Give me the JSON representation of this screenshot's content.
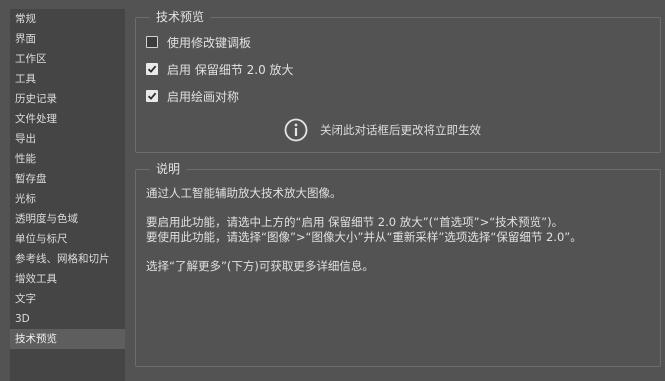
{
  "sidebar": {
    "items": [
      {
        "label": "常规"
      },
      {
        "label": "界面"
      },
      {
        "label": "工作区"
      },
      {
        "label": "工具"
      },
      {
        "label": "历史记录"
      },
      {
        "label": "文件处理"
      },
      {
        "label": "导出"
      },
      {
        "label": "性能"
      },
      {
        "label": "暂存盘"
      },
      {
        "label": "光标"
      },
      {
        "label": "透明度与色域"
      },
      {
        "label": "单位与标尺"
      },
      {
        "label": "参考线、网格和切片"
      },
      {
        "label": "增效工具"
      },
      {
        "label": "文字"
      },
      {
        "label": "3D"
      },
      {
        "label": "技术预览"
      }
    ],
    "selected": "技术预览"
  },
  "tech_preview": {
    "title": "技术预览",
    "options": [
      {
        "label": "使用修改键调板",
        "checked": false
      },
      {
        "label": "启用 保留细节 2.0 放大",
        "checked": true
      },
      {
        "label": "启用绘画对称",
        "checked": true
      }
    ],
    "info_text": "关闭此对话框后更改将立即生效"
  },
  "description": {
    "title": "说明",
    "lines": [
      "通过人工智能辅助放大技术放大图像。",
      "要启用此功能，请选中上方的“启用 保留细节 2.0 放大”(“首选项”>“技术预览”)。",
      "要使用此功能，请选择“图像”>“图像大小”并从“重新采样”选项选择“保留细节 2.0”。",
      "选择“了解更多”(下方)可获取更多详细信息。"
    ]
  }
}
